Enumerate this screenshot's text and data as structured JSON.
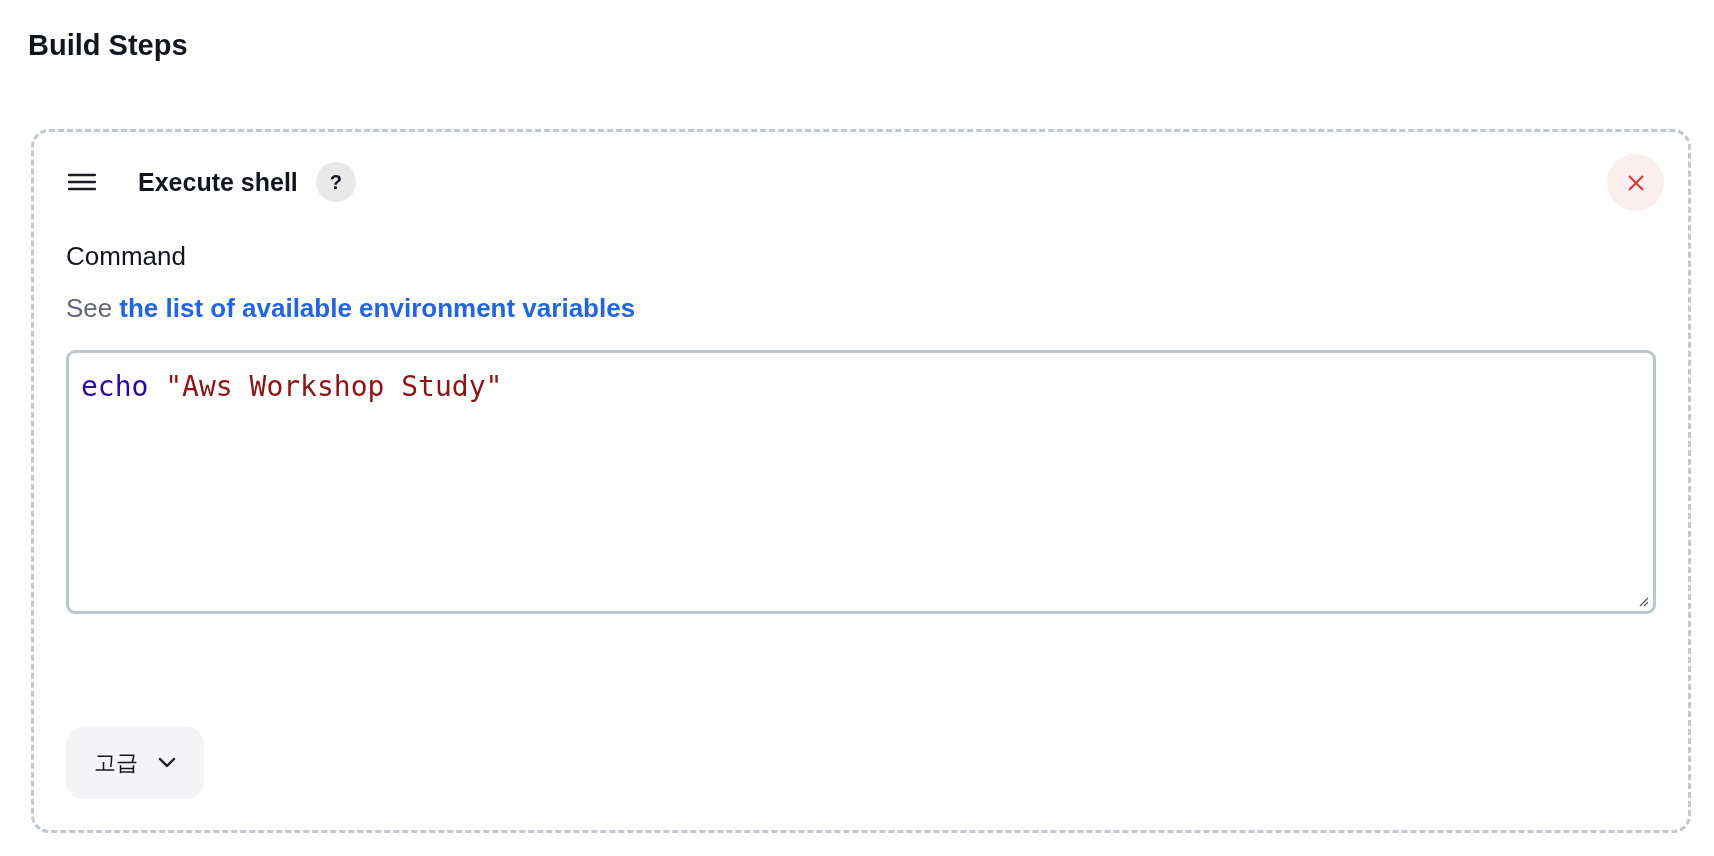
{
  "page_title": "Build Steps",
  "step": {
    "title": "Execute shell",
    "help": "?",
    "field_label": "Command",
    "hint_prefix": "See",
    "hint_link": "the list of available environment variables",
    "code": [
      {
        "kind": "keyword",
        "text": "echo"
      },
      {
        "kind": "string",
        "text": "\"Aws Workshop Study\""
      }
    ],
    "advanced_button": {
      "label": "고급",
      "expanded": false
    }
  }
}
